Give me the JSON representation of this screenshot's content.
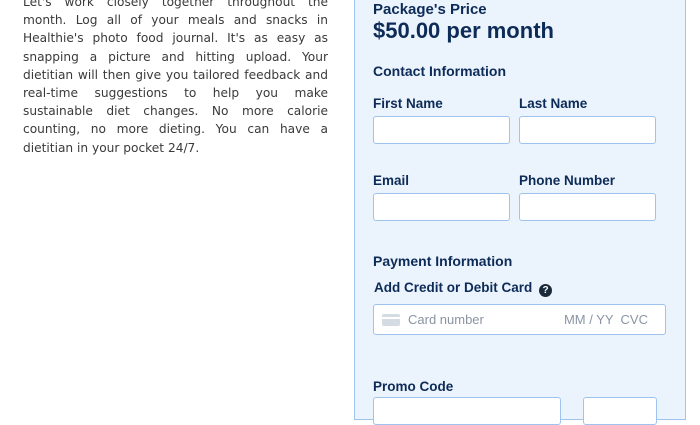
{
  "description": "Let's work closely together throughout the month. Log all of your meals and snacks in Healthie's photo food journal. It's as easy as snapping a picture and hitting upload. Your dietitian will then give you tailored feedback and real-time suggestions to help you make sustainable diet changes. No more calorie counting, no more dieting. You can have a dietitian in your pocket 24/7.",
  "checkout": {
    "price_label": "Package's Price",
    "price_value": "$50.00 per month",
    "contact": {
      "heading": "Contact Information",
      "first_name": {
        "label": "First Name",
        "value": ""
      },
      "last_name": {
        "label": "Last Name",
        "value": ""
      },
      "email": {
        "label": "Email",
        "value": ""
      },
      "phone": {
        "label": "Phone Number",
        "value": ""
      }
    },
    "payment": {
      "heading": "Payment Information",
      "add_card_label": "Add Credit or Debit Card",
      "help_icon": "question-circle-icon",
      "card_icon": "credit-card-icon",
      "card_number_placeholder": "Card number",
      "expiry_cvc_placeholder": "MM / YY  CVC"
    },
    "promo": {
      "label": "Promo Code",
      "value": "",
      "apply_label": ""
    }
  },
  "colors": {
    "panel_bg": "#ebf3fd",
    "panel_border": "#9fc3ef",
    "heading_text": "#0d2b57",
    "body_text": "#3a3a3a"
  }
}
